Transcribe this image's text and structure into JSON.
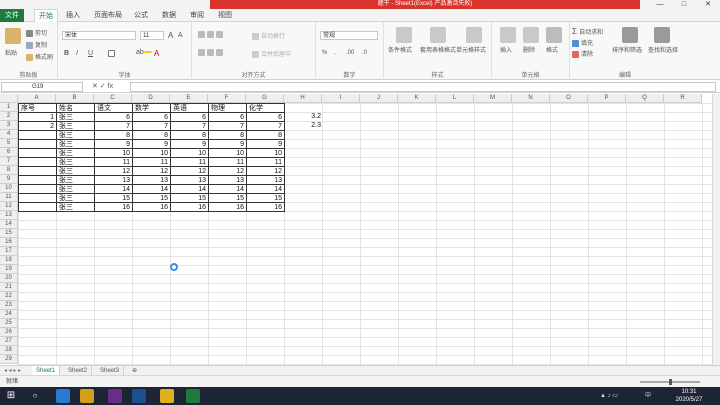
{
  "titlebar": {
    "text": "题干 - Sheet1(Excel) 产品激活失败)",
    "controls": [
      "—",
      "□",
      "✕"
    ]
  },
  "menu": {
    "file": "文件",
    "tabs": [
      "开始",
      "插入",
      "页面布局",
      "公式",
      "数据",
      "审阅",
      "视图"
    ],
    "active_tab": "开始"
  },
  "ribbon": {
    "clipboard": {
      "label": "剪贴板",
      "paste": "粘贴",
      "cut": "剪切",
      "copy": "复制",
      "format_painter": "格式刷"
    },
    "font": {
      "label": "字体",
      "font_name": "宋体",
      "font_size": "11",
      "bold": "B",
      "italic": "I",
      "underline": "U",
      "grow": "A",
      "shrink": "A",
      "font_color": "A",
      "fill_color": "ab"
    },
    "alignment": {
      "label": "对齐方式",
      "wrap": "自动换行",
      "merge": "合并后居中"
    },
    "number": {
      "label": "数字",
      "format": "常规",
      "percent": "%",
      "comma": ",",
      "increase_decimal": ".00",
      "decrease_decimal": ".0"
    },
    "styles": {
      "label": "样式",
      "conditional": "条件格式",
      "table_format": "套用表格格式",
      "cell_styles": "单元格样式"
    },
    "cells": {
      "label": "单元格",
      "insert": "插入",
      "delete": "删除",
      "format": "格式"
    },
    "editing": {
      "label": "编辑",
      "autosum": "自动求和",
      "fill": "填充",
      "clear": "清除",
      "sort_filter": "排序和筛选",
      "find_select": "查找和选择"
    }
  },
  "formula_bar": {
    "name_box": "G19",
    "icons": "✕ ✓ fx",
    "value": ""
  },
  "columns": [
    "A",
    "B",
    "C",
    "D",
    "E",
    "F",
    "G",
    "H",
    "I",
    "J",
    "K",
    "L",
    "M",
    "N",
    "O",
    "P",
    "Q",
    "R"
  ],
  "rows": [
    "1",
    "2",
    "3",
    "4",
    "5",
    "6",
    "7",
    "8",
    "9",
    "10",
    "11",
    "12",
    "13",
    "14",
    "15",
    "16",
    "17",
    "18",
    "19",
    "20",
    "21",
    "22",
    "23",
    "24",
    "25",
    "26",
    "27",
    "28",
    "29"
  ],
  "cells": {
    "A1": "序号",
    "B1": "姓名",
    "C1": "语文",
    "D1": "数学",
    "E1": "英语",
    "F1": "物理",
    "G1": "化学",
    "A2": "1",
    "A3": "2",
    "B2": "张三",
    "B3": "张三",
    "B4": "张三",
    "B5": "张三",
    "B6": "张三",
    "B7": "张三",
    "B8": "张三",
    "B9": "张三",
    "B10": "张三",
    "B11": "张三",
    "B12": "张三",
    "C2": "6",
    "C3": "7",
    "C4": "8",
    "C5": "9",
    "C6": "10",
    "C7": "11",
    "C8": "12",
    "C9": "13",
    "C10": "14",
    "C11": "15",
    "C12": "16",
    "D2": "6",
    "D3": "7",
    "D4": "8",
    "D5": "9",
    "D6": "10",
    "D7": "11",
    "D8": "12",
    "D9": "13",
    "D10": "14",
    "D11": "15",
    "D12": "16",
    "E2": "6",
    "E3": "7",
    "E4": "8",
    "E5": "9",
    "E6": "10",
    "E7": "11",
    "E8": "12",
    "E9": "13",
    "E10": "14",
    "E11": "15",
    "E12": "16",
    "F2": "6",
    "F3": "7",
    "F4": "8",
    "F5": "9",
    "F6": "10",
    "F7": "11",
    "F8": "12",
    "F9": "13",
    "F10": "14",
    "F11": "15",
    "F12": "16",
    "G2": "6",
    "G3": "7",
    "G4": "8",
    "G5": "9",
    "G6": "10",
    "G7": "11",
    "G8": "12",
    "G9": "13",
    "G10": "14",
    "G11": "15",
    "G12": "16",
    "H2": "3.2",
    "H3": "2.3"
  },
  "sheets": {
    "tabs": [
      "Sheet1",
      "Sheet2",
      "Sheet3"
    ],
    "active": "Sheet1",
    "nav": "◂ ◂ ▸ ▸"
  },
  "status": {
    "mode": "就绪"
  },
  "taskbar": {
    "time": "10:31",
    "date": "2020/5/27",
    "ime": "中"
  },
  "colors": {
    "excel_green": "#1f7a3e",
    "title_red": "#d9342b",
    "taskbar": "#1d2433"
  }
}
